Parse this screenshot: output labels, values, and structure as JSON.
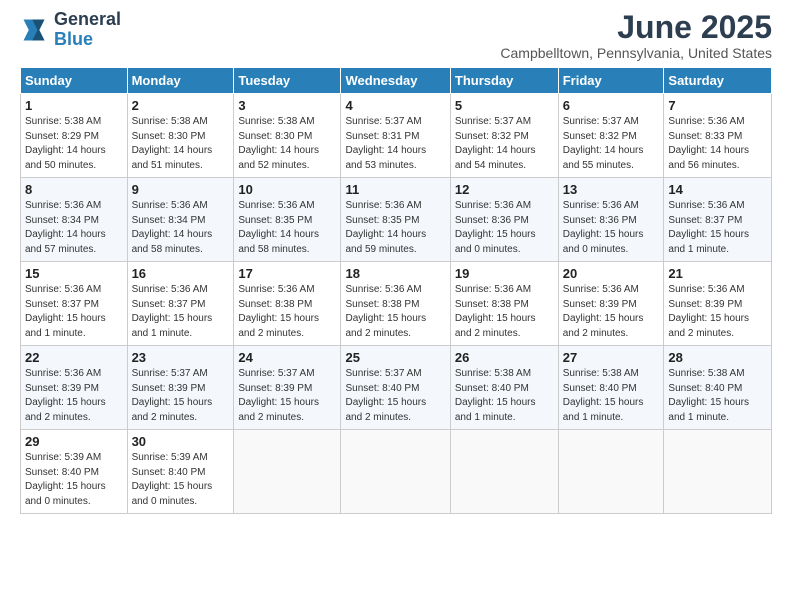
{
  "logo": {
    "general": "General",
    "blue": "Blue"
  },
  "title": "June 2025",
  "location": "Campbelltown, Pennsylvania, United States",
  "weekdays": [
    "Sunday",
    "Monday",
    "Tuesday",
    "Wednesday",
    "Thursday",
    "Friday",
    "Saturday"
  ],
  "weeks": [
    [
      {
        "day": "1",
        "info": "Sunrise: 5:38 AM\nSunset: 8:29 PM\nDaylight: 14 hours\nand 50 minutes."
      },
      {
        "day": "2",
        "info": "Sunrise: 5:38 AM\nSunset: 8:30 PM\nDaylight: 14 hours\nand 51 minutes."
      },
      {
        "day": "3",
        "info": "Sunrise: 5:38 AM\nSunset: 8:30 PM\nDaylight: 14 hours\nand 52 minutes."
      },
      {
        "day": "4",
        "info": "Sunrise: 5:37 AM\nSunset: 8:31 PM\nDaylight: 14 hours\nand 53 minutes."
      },
      {
        "day": "5",
        "info": "Sunrise: 5:37 AM\nSunset: 8:32 PM\nDaylight: 14 hours\nand 54 minutes."
      },
      {
        "day": "6",
        "info": "Sunrise: 5:37 AM\nSunset: 8:32 PM\nDaylight: 14 hours\nand 55 minutes."
      },
      {
        "day": "7",
        "info": "Sunrise: 5:36 AM\nSunset: 8:33 PM\nDaylight: 14 hours\nand 56 minutes."
      }
    ],
    [
      {
        "day": "8",
        "info": "Sunrise: 5:36 AM\nSunset: 8:34 PM\nDaylight: 14 hours\nand 57 minutes."
      },
      {
        "day": "9",
        "info": "Sunrise: 5:36 AM\nSunset: 8:34 PM\nDaylight: 14 hours\nand 58 minutes."
      },
      {
        "day": "10",
        "info": "Sunrise: 5:36 AM\nSunset: 8:35 PM\nDaylight: 14 hours\nand 58 minutes."
      },
      {
        "day": "11",
        "info": "Sunrise: 5:36 AM\nSunset: 8:35 PM\nDaylight: 14 hours\nand 59 minutes."
      },
      {
        "day": "12",
        "info": "Sunrise: 5:36 AM\nSunset: 8:36 PM\nDaylight: 15 hours\nand 0 minutes."
      },
      {
        "day": "13",
        "info": "Sunrise: 5:36 AM\nSunset: 8:36 PM\nDaylight: 15 hours\nand 0 minutes."
      },
      {
        "day": "14",
        "info": "Sunrise: 5:36 AM\nSunset: 8:37 PM\nDaylight: 15 hours\nand 1 minute."
      }
    ],
    [
      {
        "day": "15",
        "info": "Sunrise: 5:36 AM\nSunset: 8:37 PM\nDaylight: 15 hours\nand 1 minute."
      },
      {
        "day": "16",
        "info": "Sunrise: 5:36 AM\nSunset: 8:37 PM\nDaylight: 15 hours\nand 1 minute."
      },
      {
        "day": "17",
        "info": "Sunrise: 5:36 AM\nSunset: 8:38 PM\nDaylight: 15 hours\nand 2 minutes."
      },
      {
        "day": "18",
        "info": "Sunrise: 5:36 AM\nSunset: 8:38 PM\nDaylight: 15 hours\nand 2 minutes."
      },
      {
        "day": "19",
        "info": "Sunrise: 5:36 AM\nSunset: 8:38 PM\nDaylight: 15 hours\nand 2 minutes."
      },
      {
        "day": "20",
        "info": "Sunrise: 5:36 AM\nSunset: 8:39 PM\nDaylight: 15 hours\nand 2 minutes."
      },
      {
        "day": "21",
        "info": "Sunrise: 5:36 AM\nSunset: 8:39 PM\nDaylight: 15 hours\nand 2 minutes."
      }
    ],
    [
      {
        "day": "22",
        "info": "Sunrise: 5:36 AM\nSunset: 8:39 PM\nDaylight: 15 hours\nand 2 minutes."
      },
      {
        "day": "23",
        "info": "Sunrise: 5:37 AM\nSunset: 8:39 PM\nDaylight: 15 hours\nand 2 minutes."
      },
      {
        "day": "24",
        "info": "Sunrise: 5:37 AM\nSunset: 8:39 PM\nDaylight: 15 hours\nand 2 minutes."
      },
      {
        "day": "25",
        "info": "Sunrise: 5:37 AM\nSunset: 8:40 PM\nDaylight: 15 hours\nand 2 minutes."
      },
      {
        "day": "26",
        "info": "Sunrise: 5:38 AM\nSunset: 8:40 PM\nDaylight: 15 hours\nand 1 minute."
      },
      {
        "day": "27",
        "info": "Sunrise: 5:38 AM\nSunset: 8:40 PM\nDaylight: 15 hours\nand 1 minute."
      },
      {
        "day": "28",
        "info": "Sunrise: 5:38 AM\nSunset: 8:40 PM\nDaylight: 15 hours\nand 1 minute."
      }
    ],
    [
      {
        "day": "29",
        "info": "Sunrise: 5:39 AM\nSunset: 8:40 PM\nDaylight: 15 hours\nand 0 minutes."
      },
      {
        "day": "30",
        "info": "Sunrise: 5:39 AM\nSunset: 8:40 PM\nDaylight: 15 hours\nand 0 minutes."
      },
      {
        "day": "",
        "info": ""
      },
      {
        "day": "",
        "info": ""
      },
      {
        "day": "",
        "info": ""
      },
      {
        "day": "",
        "info": ""
      },
      {
        "day": "",
        "info": ""
      }
    ]
  ]
}
